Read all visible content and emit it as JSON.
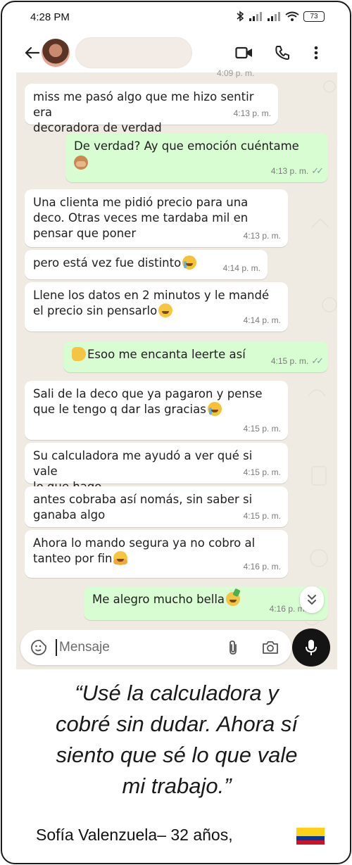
{
  "status_bar": {
    "time": "4:28 PM",
    "battery": "73"
  },
  "app_bar": {
    "contact_name": ""
  },
  "chat": {
    "cut_off_time": "4:09 p. m.",
    "messages": [
      {
        "direction": "in",
        "text": "miss me pasó algo que me hizo sentir era\ndecoradora de verdad",
        "time": "4:13 p. m."
      },
      {
        "direction": "out",
        "text": "De verdad? Ay que emoción cuéntame",
        "emoji": "see-no-evil-monkey",
        "time": "4:13 p. m.",
        "read": true
      },
      {
        "direction": "in",
        "text": "Una clienta me pidió precio para una\ndeco. Otras veces me tardaba mil en\npensar que poner",
        "time": "4:13 p. m."
      },
      {
        "direction": "in",
        "text": "pero está vez fue distinto",
        "emoji": "loudly-crying-face",
        "time": "4:14 p. m."
      },
      {
        "direction": "in",
        "text": "Llene los datos en 2 minutos y le mandé\nel precio sin pensarlo",
        "emoji": "face-with-hand-over-mouth",
        "time": "4:14 p. m."
      },
      {
        "direction": "out",
        "text": "Esoo me encanta leerte así",
        "emoji": "clapping-hands",
        "time": "4:15 p. m.",
        "read": true
      },
      {
        "direction": "in",
        "text": "Sali de la deco que ya pagaron y pense\nque le tengo q dar las gracias",
        "emoji": "loudly-crying-face",
        "time": "4:15 p. m."
      },
      {
        "direction": "in",
        "text": "Su calculadora me ayudó a ver qué si vale\nlo que hago",
        "time": "4:15 p. m."
      },
      {
        "direction": "in",
        "text": "antes cobraba así nomás, sin saber si\nganaba algo",
        "time": "4:15 p. m."
      },
      {
        "direction": "in",
        "text": "Ahora lo mando segura ya no cobro al\ntanteo por fin",
        "emoji": "hugging-face",
        "time": "4:16 p. m."
      },
      {
        "direction": "out",
        "text": "Me alegro mucho bella",
        "emoji": "partying-face",
        "time": "4:16 p. m.",
        "read": true
      }
    ]
  },
  "composer": {
    "placeholder": "Mensaje"
  },
  "testimonial": {
    "quote": "“Usé la calculadora y\ncobré sin dudar. Ahora sí\nsiento que sé lo que vale\nmi trabajo.”",
    "author": "Sofía Valenzuela– 32 años,",
    "flag": "Colombia"
  },
  "colors": {
    "incoming_bubble": "#ffffff",
    "outgoing_bubble": "#d9fdd3",
    "chat_background": "#efeae2",
    "read_ticks": "#8a9aa2",
    "mic_button": "#141414"
  },
  "icons": [
    "back-arrow-icon",
    "video-call-icon",
    "phone-call-icon",
    "more-vert-icon",
    "sticker-icon",
    "attach-icon",
    "camera-icon",
    "mic-icon",
    "double-chevron-down-icon",
    "bluetooth-icon",
    "signal-icon",
    "wifi-icon"
  ]
}
